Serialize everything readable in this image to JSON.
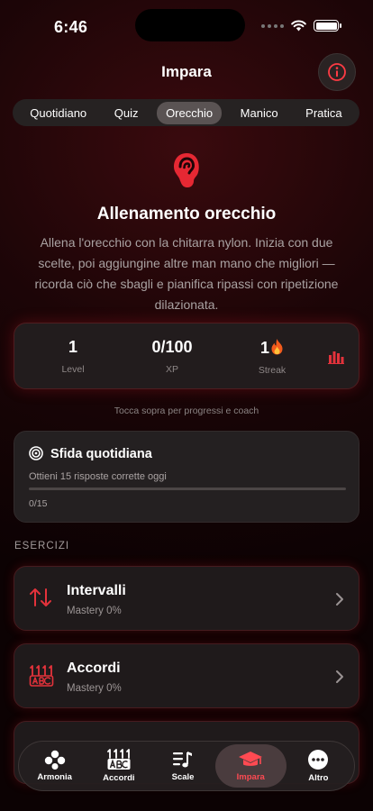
{
  "status_bar": {
    "time": "6:46"
  },
  "header": {
    "title": "Impara",
    "info_icon": "info-icon"
  },
  "segments": {
    "items": [
      "Quotidiano",
      "Quiz",
      "Orecchio",
      "Manico",
      "Pratica"
    ],
    "active": "Orecchio"
  },
  "hero": {
    "icon": "ear-icon",
    "title": "Allenamento orecchio",
    "description": "Allena l'orecchio con la chitarra nylon. Inizia con due scelte, poi aggiungine altre man mano che migliori — ricorda ciò che sbagli e pianifica ripassi con ripetizione dilazionata."
  },
  "stats": {
    "level_value": "1",
    "level_label": "Level",
    "xp_value": "0/100",
    "xp_label": "XP",
    "streak_value": "1",
    "streak_label": "Streak",
    "hint": "Tocca sopra per progressi e coach"
  },
  "challenge": {
    "title": "Sfida quotidiana",
    "subtitle": "Ottieni 15 risposte corrette oggi",
    "progress": 0,
    "count": "0/15"
  },
  "exercises": {
    "section_label": "ESERCIZI",
    "items": [
      {
        "title": "Intervalli",
        "subtitle": "Mastery 0%"
      },
      {
        "title": "Accordi",
        "subtitle": "Mastery 0%"
      }
    ]
  },
  "tabbar": {
    "items": [
      {
        "label": "Armonia",
        "icon": "harmony-icon"
      },
      {
        "label": "Accordi",
        "icon": "chord-icon"
      },
      {
        "label": "Scale",
        "icon": "scale-icon"
      },
      {
        "label": "Impara",
        "icon": "graduation-cap-icon"
      },
      {
        "label": "Altro",
        "icon": "more-icon"
      }
    ],
    "active": "Impara"
  },
  "colors": {
    "accent": "#e3323b",
    "background": "#1c0507",
    "card": "#221c1d"
  }
}
